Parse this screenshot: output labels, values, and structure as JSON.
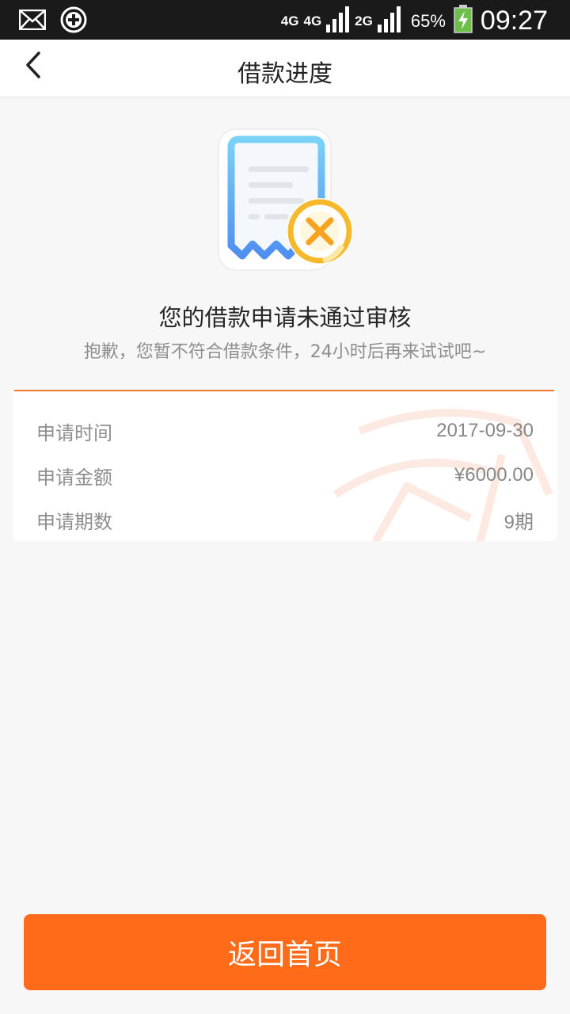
{
  "status_bar": {
    "network1": "4G",
    "network2": "4G",
    "network3": "2G",
    "battery_percent": "65%",
    "time": "09:27"
  },
  "header": {
    "title": "借款进度"
  },
  "result": {
    "title": "您的借款申请未通过审核",
    "subtitle": "抱歉，您暂不符合借款条件，24小时后再来试试吧~"
  },
  "details": [
    {
      "label": "申请时间",
      "value": "2017-09-30"
    },
    {
      "label": "申请金额",
      "value": "¥6000.00"
    },
    {
      "label": "申请期数",
      "value": "9期"
    }
  ],
  "actions": {
    "home_label": "返回首页"
  },
  "colors": {
    "accent": "#ff6b18",
    "divider": "#f07a2d",
    "icon_blue": "#5ab0f5",
    "icon_yellow": "#f7b92b"
  }
}
